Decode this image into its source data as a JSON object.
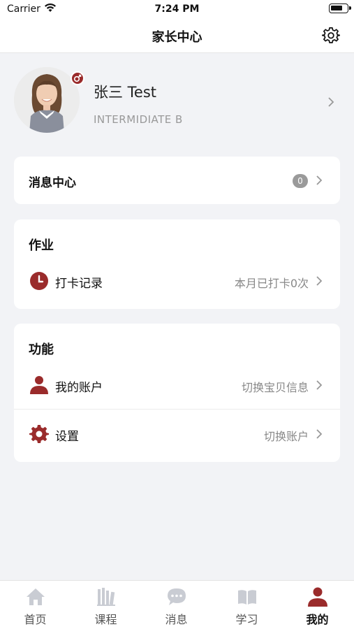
{
  "status_bar": {
    "carrier": "Carrier",
    "time": "7:24 PM"
  },
  "nav": {
    "title": "家长中心",
    "settings_icon": "gear-icon"
  },
  "profile": {
    "name": "张三 Test",
    "level": "INTERMIDIATE B",
    "gender_icon": "male-icon"
  },
  "messages": {
    "label": "消息中心",
    "count": "0"
  },
  "homework": {
    "title": "作业",
    "checkin": {
      "label": "打卡记录",
      "value": "本月已打卡0次",
      "icon": "clock-icon"
    }
  },
  "functions": {
    "title": "功能",
    "account": {
      "label": "我的账户",
      "value": "切换宝贝信息",
      "icon": "person-icon"
    },
    "settings": {
      "label": "设置",
      "value": "切换账户",
      "icon": "gear-icon"
    }
  },
  "tabs": [
    {
      "label": "首页",
      "icon": "home-icon"
    },
    {
      "label": "课程",
      "icon": "books-icon"
    },
    {
      "label": "消息",
      "icon": "chat-bubble-icon"
    },
    {
      "label": "学习",
      "icon": "open-book-icon"
    },
    {
      "label": "我的",
      "icon": "person-icon"
    }
  ],
  "colors": {
    "accent": "#9a2b2b",
    "inactive_icon": "#c9ccd3",
    "background": "#f2f3f6"
  }
}
